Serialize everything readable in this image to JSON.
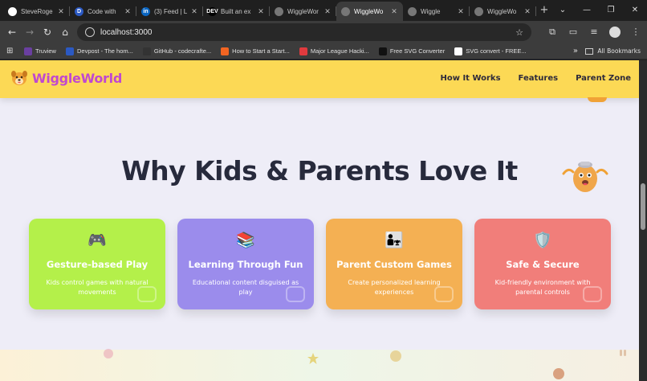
{
  "browser": {
    "tabs": [
      {
        "title": "SteveRoge",
        "fav_color": "#ffffff",
        "fav_glyph": "",
        "active": false
      },
      {
        "title": "Code with",
        "fav_color": "#2b59c3",
        "fav_glyph": "D",
        "active": false
      },
      {
        "title": "(3) Feed | L",
        "fav_color": "#0a66c2",
        "fav_glyph": "in",
        "active": false
      },
      {
        "title": "Built an ex",
        "fav_color": "#000000",
        "fav_glyph": "DEV",
        "active": false
      },
      {
        "title": "WiggleWor",
        "fav_color": "#777777",
        "fav_glyph": "",
        "active": false
      },
      {
        "title": "WiggleWo",
        "fav_color": "#777777",
        "fav_glyph": "",
        "active": true
      },
      {
        "title": "Wiggle",
        "fav_color": "#777777",
        "fav_glyph": "",
        "active": false
      },
      {
        "title": "WiggleWo",
        "fav_color": "#777777",
        "fav_glyph": "",
        "active": false
      }
    ],
    "new_tab_label": "+",
    "window_controls": [
      "⌄",
      "—",
      "❐",
      "✕"
    ],
    "url": "localhost:3000",
    "bookmarks": [
      {
        "label": "Truview",
        "fav_color": "#6a3fa0"
      },
      {
        "label": "Devpost - The hom...",
        "fav_color": "#2b59c3"
      },
      {
        "label": "GitHub - codecrafte...",
        "fav_color": "#333333"
      },
      {
        "label": "How to Start a Start...",
        "fav_color": "#f26522"
      },
      {
        "label": "Major League Hacki...",
        "fav_color": "#e03a3e"
      },
      {
        "label": "Free SVG Converter",
        "fav_color": "#111111"
      },
      {
        "label": "SVG convert - FREE...",
        "fav_color": "#ffffff"
      }
    ],
    "bookmarks_more": "»",
    "all_bookmarks": "All Bookmarks"
  },
  "site": {
    "logo_text": "WiggleWorld",
    "nav": [
      "How It Works",
      "Features",
      "Parent Zone"
    ],
    "section_title": "Why Kids & Parents Love It",
    "features": [
      {
        "icon": "🎮",
        "icon_name": "gamepad-icon",
        "title": "Gesture-based Play",
        "description": "Kids control games with natural movements",
        "color": "#b4f04a"
      },
      {
        "icon": "📚",
        "icon_name": "books-icon",
        "title": "Learning Through Fun",
        "description": "Educational content disguised as play",
        "color": "#9b8cec"
      },
      {
        "icon": "👨‍👧",
        "icon_name": "family-icon",
        "title": "Parent Custom Games",
        "description": "Create personalized learning experiences",
        "color": "#f4b053"
      },
      {
        "icon": "🛡️",
        "icon_name": "shield-icon",
        "title": "Safe & Secure",
        "description": "Kid-friendly environment with parental controls",
        "color": "#f17e7a"
      }
    ],
    "header_color": "#fcd955",
    "logo_color": "#c048d0",
    "title_color": "#272a3c"
  }
}
